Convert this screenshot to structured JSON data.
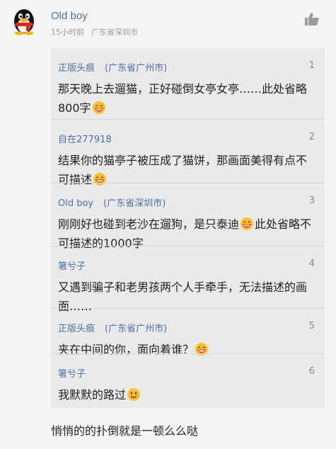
{
  "post": {
    "username": "Old boy",
    "time": "15小时前",
    "location": "广东省深圳市"
  },
  "icons": {
    "avatar": "qq-penguin-avatar",
    "like": "thumbs-up-icon"
  },
  "replies": [
    {
      "author": "正版头痕",
      "location": "(广东省广州市)",
      "number": "1",
      "text_a": "那天晚上去遛猫，正好碰倒女亭女亭……此处省略800字",
      "emoji": "laughing-face-icon",
      "text_b": ""
    },
    {
      "author": "自在277918",
      "location": "",
      "number": "2",
      "text_a": "结果你的猫亭子被压成了猫饼，那画面美得有点不可描述",
      "emoji": "laughing-face-icon",
      "text_b": ""
    },
    {
      "author": "Old boy",
      "location": "(广东省深圳市)",
      "number": "3",
      "text_a": "刚刚好也碰到老沙在遛狗，是只泰迪",
      "emoji": "laughing-face-icon",
      "text_b": "此处省略不可描述的1000字"
    },
    {
      "author": "箸兮子",
      "location": "",
      "number": "4",
      "text_a": "又遇到骗子和老男孩两个人手牵手，无法描述的画面……",
      "emoji": "",
      "text_b": ""
    },
    {
      "author": "正版头痕",
      "location": "(广东省广州市)",
      "number": "5",
      "text_a": "夹在中间的你，面向着谁？",
      "emoji": "laughing-face-icon",
      "text_b": ""
    },
    {
      "author": "箸兮子",
      "location": "",
      "number": "6",
      "text_a": "我默默的路过",
      "emoji": "smiling-face-icon",
      "text_b": ""
    }
  ],
  "footer_text": "悄悄的的扑倒就是一顿么么哒"
}
